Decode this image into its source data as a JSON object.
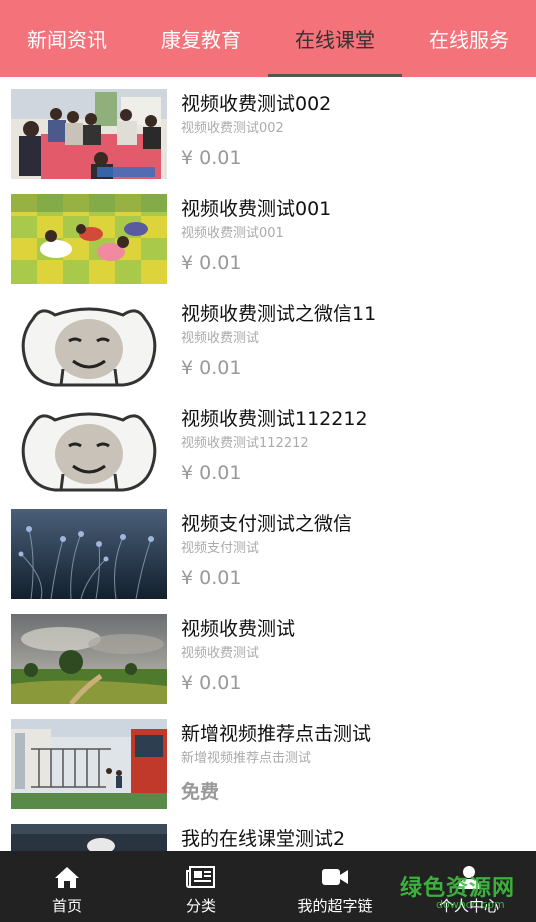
{
  "tabs": [
    {
      "label": "新闻资讯",
      "active": false
    },
    {
      "label": "康复教育",
      "active": false
    },
    {
      "label": "在线课堂",
      "active": true
    },
    {
      "label": "在线服务",
      "active": false
    }
  ],
  "items": [
    {
      "title": "视频收费测试002",
      "subtitle": "视频收费测试002",
      "price": "¥ 0.01",
      "thumb": "classroom-photo"
    },
    {
      "title": "视频收费测试001",
      "subtitle": "视频收费测试001",
      "price": "¥ 0.01",
      "thumb": "play-mat-photo"
    },
    {
      "title": "视频收费测试之微信11",
      "subtitle": "视频收费测试",
      "price": "¥ 0.01",
      "thumb": "cartoon-face"
    },
    {
      "title": "视频收费测试112212",
      "subtitle": "视频收费测试112212",
      "price": "¥ 0.01",
      "thumb": "cartoon-face"
    },
    {
      "title": "视频支付测试之微信",
      "subtitle": "视频支付测试",
      "price": "¥ 0.01",
      "thumb": "night-plants-photo"
    },
    {
      "title": "视频收费测试",
      "subtitle": "视频收费测试",
      "price": "¥ 0.01",
      "thumb": "landscape-photo"
    },
    {
      "title": "新增视频推荐点击测试",
      "subtitle": "新增视频推荐点击测试",
      "price": "免费",
      "thumb": "school-gate-photo"
    },
    {
      "title": "我的在线课堂测试2",
      "subtitle": "",
      "price": "",
      "thumb": "partial-photo"
    }
  ],
  "bottom_nav": [
    {
      "label": "首页",
      "icon": "home-icon"
    },
    {
      "label": "分类",
      "icon": "newspaper-icon"
    },
    {
      "label": "我的超字链",
      "icon": "video-camera-icon"
    },
    {
      "label": "个人中心",
      "icon": "person-icon"
    }
  ],
  "watermark": {
    "text": "绿色资源网",
    "sub": "downcc.com"
  },
  "colors": {
    "header": "#f4727a",
    "bottom_nav": "#222222",
    "price": "#999999",
    "watermark": "#3fbf3f"
  }
}
